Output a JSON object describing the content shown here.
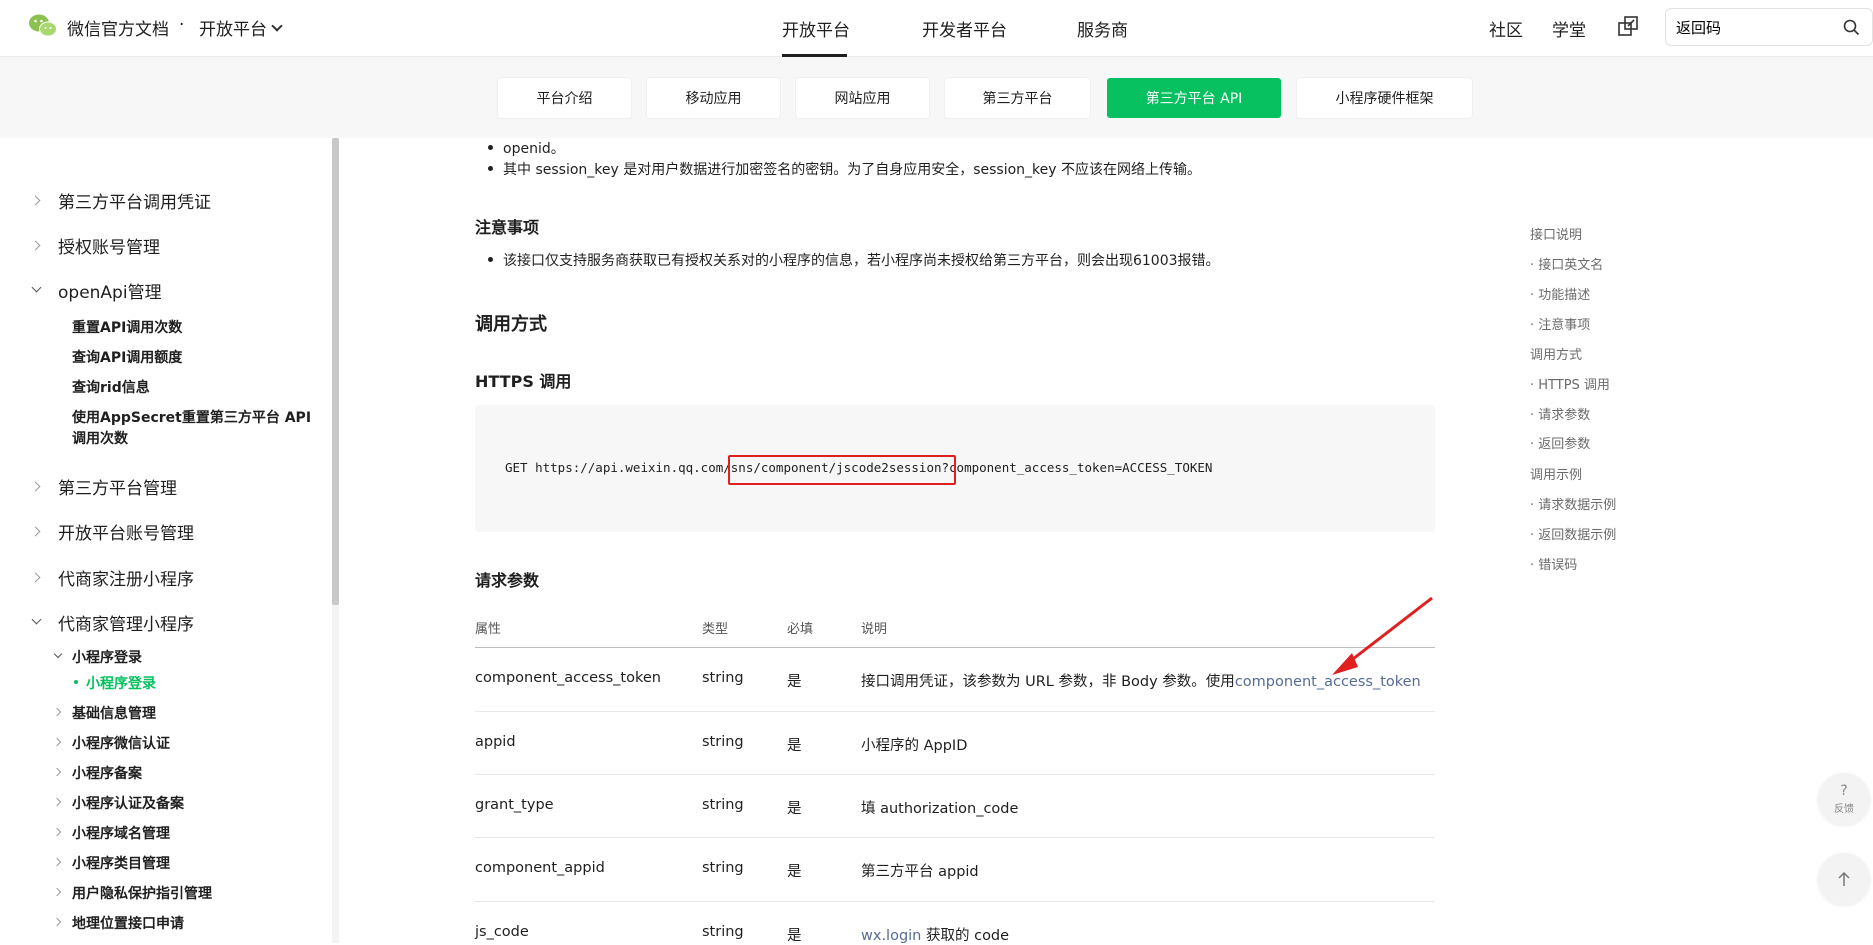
{
  "topnav": {
    "brand": "微信官方文档",
    "dot": "·",
    "brand_sub": "开放平台",
    "items": [
      "开放平台",
      "开发者平台",
      "服务商"
    ],
    "right_items": [
      "社区",
      "学堂"
    ],
    "search_value": "返回码"
  },
  "subnav": {
    "tabs": [
      "平台介绍",
      "移动应用",
      "网站应用",
      "第三方平台",
      "第三方平台 API",
      "小程序硬件框架"
    ],
    "active_index": 4
  },
  "sidebar": {
    "items": [
      {
        "label": "第三方平台调用凭证",
        "level": 1,
        "expanded": false
      },
      {
        "label": "授权账号管理",
        "level": 1,
        "expanded": false
      },
      {
        "label": "openApi管理",
        "level": 1,
        "expanded": true
      },
      {
        "label": "重置API调用次数",
        "level": 2
      },
      {
        "label": "查询API调用额度",
        "level": 2
      },
      {
        "label": "查询rid信息",
        "level": 2
      },
      {
        "label": "使用AppSecret重置第三方平台 API",
        "level": 2
      },
      {
        "label": "调用次数",
        "level": 2
      },
      {
        "label": "第三方平台管理",
        "level": 1,
        "expanded": false
      },
      {
        "label": "开放平台账号管理",
        "level": 1,
        "expanded": false
      },
      {
        "label": "代商家注册小程序",
        "level": 1,
        "expanded": false
      },
      {
        "label": "代商家管理小程序",
        "level": 1,
        "expanded": true
      },
      {
        "label": "小程序登录",
        "level": 2,
        "expanded": true
      },
      {
        "label": "小程序登录",
        "level": 3,
        "active": true
      },
      {
        "label": "基础信息管理",
        "level": 2,
        "expanded": false
      },
      {
        "label": "小程序微信认证",
        "level": 2,
        "expanded": false
      },
      {
        "label": "小程序备案",
        "level": 2,
        "expanded": false
      },
      {
        "label": "小程序认证及备案",
        "level": 2,
        "expanded": false
      },
      {
        "label": "小程序域名管理",
        "level": 2,
        "expanded": false
      },
      {
        "label": "小程序类目管理",
        "level": 2,
        "expanded": false
      },
      {
        "label": "用户隐私保护指引管理",
        "level": 2,
        "expanded": false
      },
      {
        "label": "地理位置接口申请",
        "level": 2,
        "expanded": false
      }
    ]
  },
  "content": {
    "bullet_openid": "openid。",
    "bullet_session": "其中 session_key 是对用户数据进行加密签名的密钥。为了自身应用安全，session_key 不应该在网络上传输。",
    "notice_heading": "注意事项",
    "notice_bullet": "该接口仅支持服务商获取已有授权关系对的小程序的信息，若小程序尚未授权给第三方平台，则会出现61003报错。",
    "call_heading": "调用方式",
    "https_heading": "HTTPS 调用",
    "code_prefix": "GET https://api.weixin.qq.com",
    "code_highlight": "/sns/component/jscode2session",
    "code_suffix": "?component_access_token=ACCESS_TOKEN",
    "params_heading": "请求参数",
    "table_headers": [
      "属性",
      "类型",
      "必填",
      "说明"
    ],
    "rows": [
      {
        "name": "component_access_token",
        "type": "string",
        "required": "是",
        "desc": "接口调用凭证，该参数为 URL 参数，非 Body 参数。使用",
        "link": "component_access_token"
      },
      {
        "name": "appid",
        "type": "string",
        "required": "是",
        "desc": "小程序的 AppID",
        "link": ""
      },
      {
        "name": "grant_type",
        "type": "string",
        "required": "是",
        "desc": "填 authorization_code",
        "link": ""
      },
      {
        "name": "component_appid",
        "type": "string",
        "required": "是",
        "desc": "第三方平台 appid",
        "link": ""
      },
      {
        "name": "js_code",
        "type": "string",
        "required": "是",
        "desc": "获取的 code",
        "link": "wx.login"
      }
    ]
  },
  "toc": {
    "items": [
      {
        "label": "接口说明",
        "sub": false
      },
      {
        "label": "· 接口英文名",
        "sub": true
      },
      {
        "label": "· 功能描述",
        "sub": true
      },
      {
        "label": "· 注意事项",
        "sub": true
      },
      {
        "label": "调用方式",
        "sub": false
      },
      {
        "label": "· HTTPS 调用",
        "sub": true
      },
      {
        "label": "· 请求参数",
        "sub": true
      },
      {
        "label": "· 返回参数",
        "sub": true
      },
      {
        "label": "调用示例",
        "sub": false
      },
      {
        "label": "· 请求数据示例",
        "sub": true
      },
      {
        "label": "· 返回数据示例",
        "sub": true
      },
      {
        "label": "· 错误码",
        "sub": true
      }
    ]
  },
  "floating": {
    "feedback_q": "?",
    "feedback_label": "反馈"
  },
  "colors": {
    "accent": "#07c160",
    "link": "#576b95",
    "highlight_box": "#e02020"
  }
}
